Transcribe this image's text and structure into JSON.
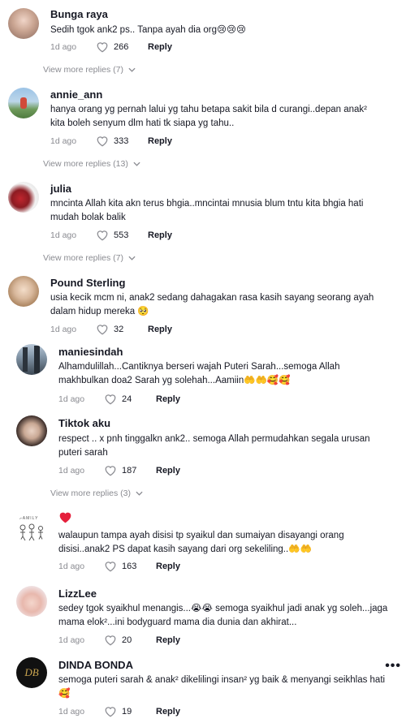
{
  "comments": [
    {
      "username": "Bunga raya",
      "text": "Sedih tgok ank2 ps.. Tanpa ayah dia org😢😢😢",
      "date": "1d ago",
      "likes": "266",
      "reply_label": "Reply",
      "view_more": "View more replies (7)"
    },
    {
      "username": "annie_ann",
      "text": "hanya orang yg pernah lalui yg tahu betapa sakit bila d curangi..depan anak² kita boleh senyum dlm hati tk siapa yg tahu..",
      "date": "1d ago",
      "likes": "333",
      "reply_label": "Reply",
      "view_more": "View more replies (13)"
    },
    {
      "username": "julia",
      "text": "mncinta Allah kita akn terus bhgia..mncintai mnusia blum tntu kita bhgia hati mudah bolak balik",
      "date": "1d ago",
      "likes": "553",
      "reply_label": "Reply",
      "view_more": "View more replies (7)"
    },
    {
      "username": "Pound Sterling",
      "text": "usia kecik mcm ni, anak2 sedang dahagakan rasa kasih sayang seorang ayah dalam hidup mereka 🥺",
      "date": "1d ago",
      "likes": "32",
      "reply_label": "Reply"
    },
    {
      "username": "maniesindah",
      "text": "Alhamdulillah...Cantiknya berseri wajah Puteri Sarah...semoga Allah makhbulkan doa2 Sarah yg solehah...Aamiin🤲🤲🥰🥰",
      "date": "1d ago",
      "likes": "24",
      "reply_label": "Reply"
    },
    {
      "username": "Tiktok aku",
      "text": "respect .. x pnh tinggalkn ank2.. semoga Allah permudahkan segala urusan puteri sarah",
      "date": "1d ago",
      "likes": "187",
      "reply_label": "Reply",
      "view_more": "View more replies (3)"
    },
    {
      "username": "",
      "avatar_text": "FAMILY",
      "text": "walaupun tampa ayah disisi tp syaikul dan sumaiyan disayangi orang disisi..anak2 PS dapat kasih sayang dari org sekeliling..🤲🤲",
      "date": "1d ago",
      "likes": "163",
      "reply_label": "Reply"
    },
    {
      "username": "LizzLee",
      "text": "sedey tgok syaikhul menangis...😭😭 semoga syaikhul jadi anak yg soleh...jaga mama elok²...ini bodyguard mama dia dunia dan akhirat...",
      "date": "1d ago",
      "likes": "20",
      "reply_label": "Reply"
    },
    {
      "username": "DINDA BONDA",
      "avatar_text": "DB",
      "text": "semoga puteri sarah & anak² dikelilingi insan² yg baik & menyangi seikhlas hati 🥰",
      "date": "1d ago",
      "likes": "19",
      "reply_label": "Reply",
      "more_icon": "•••"
    }
  ],
  "colors": {
    "text": "#161823",
    "muted": "#8a8b91",
    "red_heart": "#e5203c"
  }
}
